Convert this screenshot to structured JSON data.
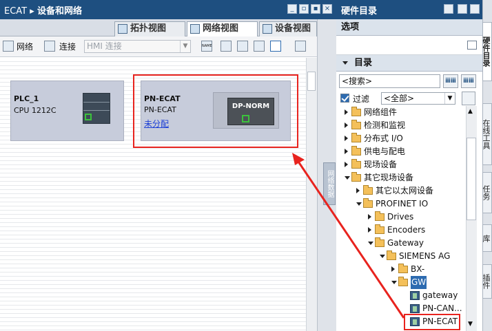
{
  "left_title": {
    "project": "ECAT",
    "sep": "▸",
    "page": "设备和网络"
  },
  "window_buttons": [
    "_",
    "▫",
    "▪",
    "×"
  ],
  "view_tabs": [
    {
      "label": "拓扑视图",
      "active": false
    },
    {
      "label": "网络视图",
      "active": true
    },
    {
      "label": "设备视图",
      "active": false
    }
  ],
  "toolbar": {
    "network_label": "网络",
    "connect_label": "连接",
    "hmi_connection": "HMI 连接",
    "name_icon": "NAME"
  },
  "devices": [
    {
      "name": "PLC_1",
      "type": "CPU 1212C"
    },
    {
      "name": "PN-ECAT",
      "type": "PN-ECAT",
      "link": "未分配",
      "module": "DP-NORM"
    }
  ],
  "collapse_tab": "网络数据",
  "catalog": {
    "title": "硬件目录",
    "options_header": "选项",
    "catalog_header": "目录",
    "search_placeholder": "<搜索>",
    "search_btn1": "ⅲⅲ",
    "search_btn2": "ⅲⅲ",
    "filter_label": "过滤",
    "filter_value": "<全部>",
    "tree": [
      {
        "label": "网络组件",
        "level": 0,
        "state": "c",
        "kind": "folder"
      },
      {
        "label": "检测和监视",
        "level": 0,
        "state": "c",
        "kind": "folder"
      },
      {
        "label": "分布式 I/O",
        "level": 0,
        "state": "c",
        "kind": "folder"
      },
      {
        "label": "供电与配电",
        "level": 0,
        "state": "c",
        "kind": "folder"
      },
      {
        "label": "现场设备",
        "level": 0,
        "state": "c",
        "kind": "folder"
      },
      {
        "label": "其它现场设备",
        "level": 0,
        "state": "e",
        "kind": "folder"
      },
      {
        "label": "其它以太网设备",
        "level": 1,
        "state": "c",
        "kind": "folder"
      },
      {
        "label": "PROFINET IO",
        "level": 1,
        "state": "e",
        "kind": "folder"
      },
      {
        "label": "Drives",
        "level": 2,
        "state": "c",
        "kind": "folder"
      },
      {
        "label": "Encoders",
        "level": 2,
        "state": "c",
        "kind": "folder"
      },
      {
        "label": "Gateway",
        "level": 2,
        "state": "e",
        "kind": "folder"
      },
      {
        "label": "SIEMENS AG",
        "level": 3,
        "state": "e",
        "kind": "folder"
      },
      {
        "label": "BX-",
        "level": 4,
        "state": "c",
        "kind": "folder"
      },
      {
        "label": "GW",
        "level": 4,
        "state": "e",
        "kind": "folder",
        "selected": true
      },
      {
        "label": "gateway",
        "level": 5,
        "state": "",
        "kind": "device"
      },
      {
        "label": "PN-CAN...",
        "level": 5,
        "state": "",
        "kind": "device"
      },
      {
        "label": "PN-ECAT",
        "level": 5,
        "state": "",
        "kind": "device",
        "highlighted": true
      }
    ]
  },
  "right_tabs": [
    "硬件目录",
    "在线工具",
    "任务",
    "库",
    "插件"
  ]
}
